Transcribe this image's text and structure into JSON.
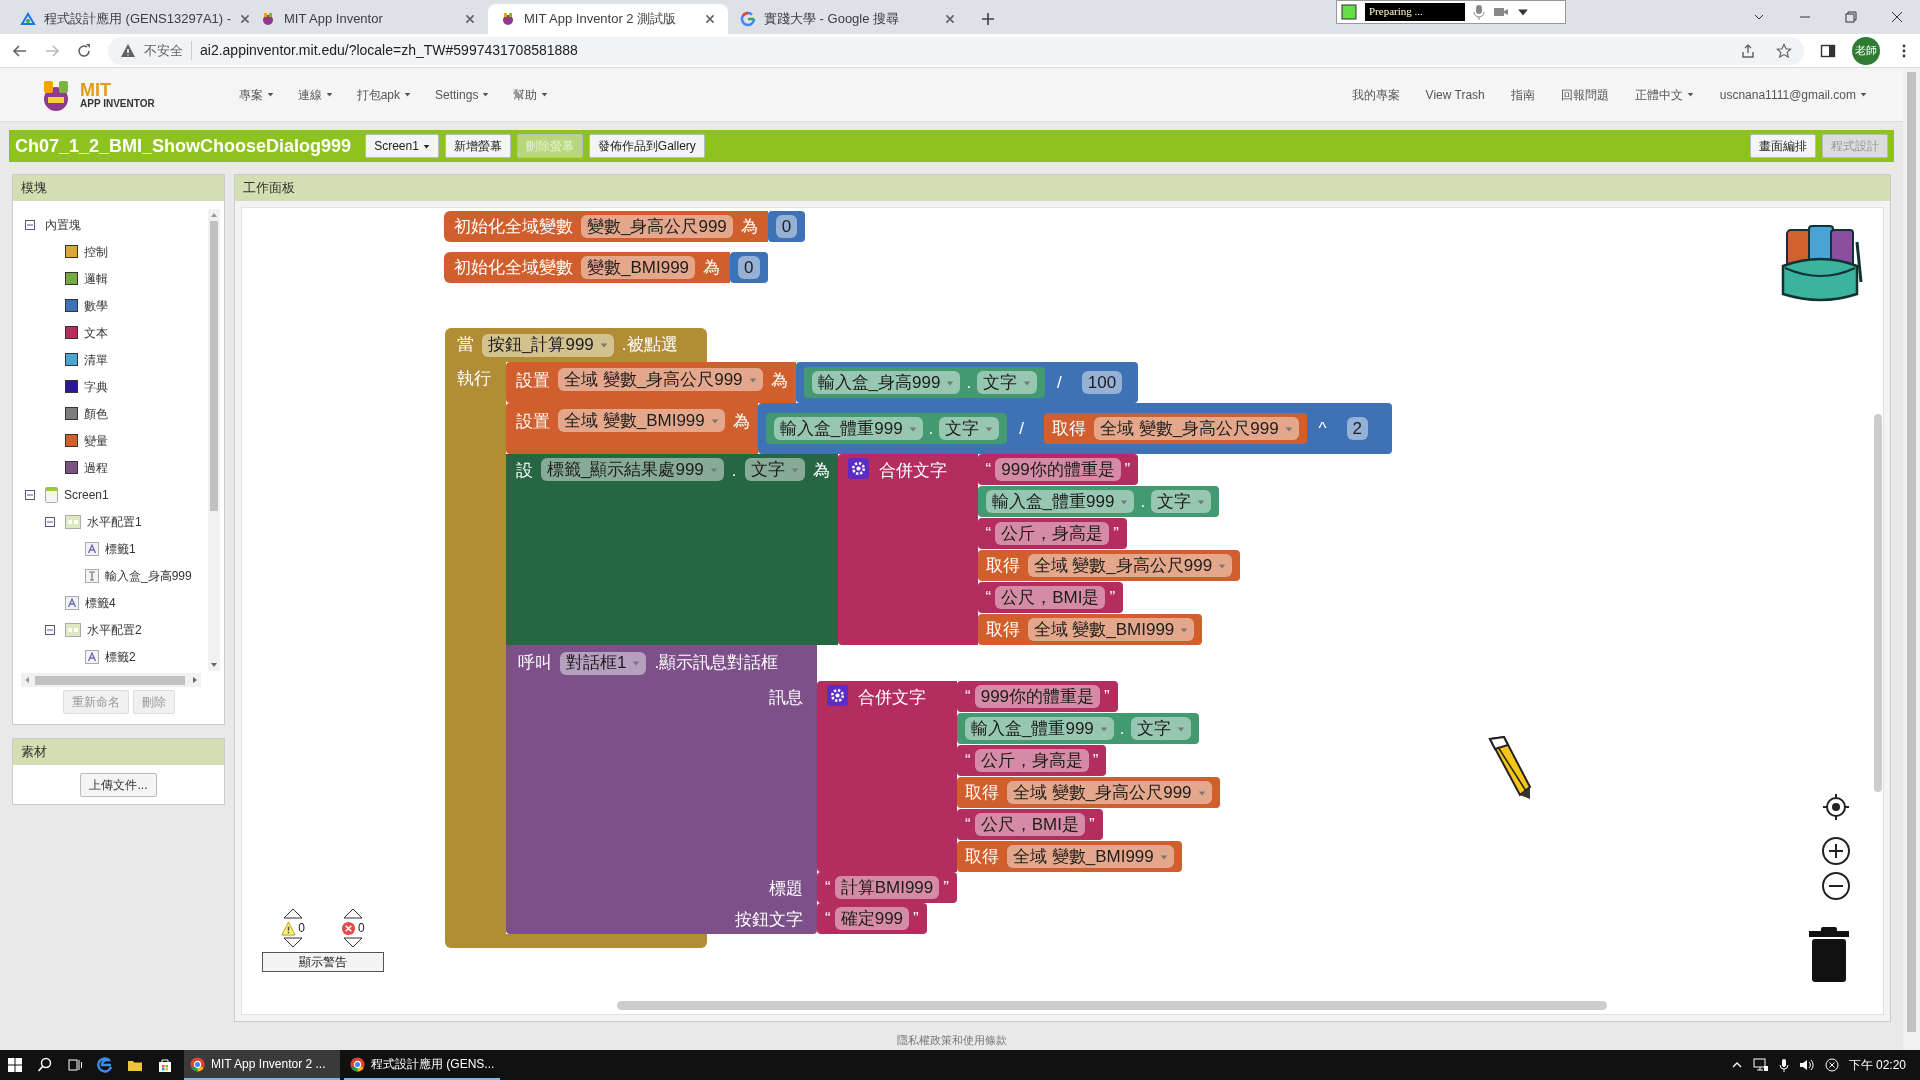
{
  "browser": {
    "tabs": [
      {
        "title": "程式設計應用 (GENS13297A1) -",
        "kind": "classroom",
        "selected": false
      },
      {
        "title": "MIT App Inventor",
        "kind": "appinventor",
        "selected": false
      },
      {
        "title": "MIT App Inventor 2 測試版",
        "kind": "appinventor",
        "selected": true
      },
      {
        "title": "實踐大學 - Google 搜尋",
        "kind": "google",
        "selected": false
      }
    ],
    "recorder": "Preparing ...",
    "security": "不安全",
    "url": "ai2.appinventor.mit.edu/?locale=zh_TW#5997431708581888",
    "profile": "老師"
  },
  "app": {
    "logo": {
      "line1": "MIT",
      "line2": "APP INVENTOR"
    },
    "menu": [
      {
        "label": "專案",
        "dropdown": true
      },
      {
        "label": "連線",
        "dropdown": true
      },
      {
        "label": "打包apk",
        "dropdown": true
      },
      {
        "label": "Settings",
        "dropdown": true
      },
      {
        "label": "幫助",
        "dropdown": true
      }
    ],
    "right_menu": [
      {
        "label": "我的專案",
        "dropdown": false
      },
      {
        "label": "View Trash",
        "dropdown": false
      },
      {
        "label": "指南",
        "dropdown": false
      },
      {
        "label": "回報問題",
        "dropdown": false
      },
      {
        "label": "正體中文",
        "dropdown": true
      },
      {
        "label": "uscnana1111@gmail.com",
        "dropdown": true
      }
    ]
  },
  "toolbar": {
    "project": "Ch07_1_2_BMI_ShowChooseDialog999",
    "buttons": [
      {
        "label": "Screen1",
        "dropdown": true,
        "disabled": false
      },
      {
        "label": "新增螢幕",
        "dropdown": false,
        "disabled": false
      },
      {
        "label": "刪除螢幕",
        "dropdown": false,
        "disabled": true
      },
      {
        "label": "發佈作品到Gallery",
        "dropdown": false,
        "disabled": false
      }
    ],
    "views": [
      {
        "label": "畫面編排",
        "selected": false
      },
      {
        "label": "程式設計",
        "selected": true
      }
    ]
  },
  "blocks_panel": {
    "title": "模塊",
    "tree": [
      {
        "label": "內置塊",
        "kind": "folder",
        "expanded": true,
        "children": [
          {
            "label": "控制",
            "kind": "category",
            "color": "#dba73b"
          },
          {
            "label": "邏輯",
            "kind": "category",
            "color": "#77ab41"
          },
          {
            "label": "數學",
            "kind": "category",
            "color": "#3f71b5"
          },
          {
            "label": "文本",
            "kind": "category",
            "color": "#b32d5e"
          },
          {
            "label": "清單",
            "kind": "category",
            "color": "#49a6d4"
          },
          {
            "label": "字典",
            "kind": "category",
            "color": "#2d1799"
          },
          {
            "label": "顏色",
            "kind": "category",
            "color": "#7d7d7d"
          },
          {
            "label": "變量",
            "kind": "category",
            "color": "#d05f2d"
          },
          {
            "label": "過程",
            "kind": "category",
            "color": "#7c5385"
          }
        ]
      },
      {
        "label": "Screen1",
        "kind": "screen",
        "expanded": true,
        "children": [
          {
            "label": "水平配置1",
            "kind": "arrangement",
            "expanded": true,
            "children": [
              {
                "label": "標籤1",
                "kind": "label"
              },
              {
                "label": "輸入盒_身高999",
                "kind": "textbox"
              }
            ]
          },
          {
            "label": "標籤4",
            "kind": "label"
          },
          {
            "label": "水平配置2",
            "kind": "arrangement",
            "expanded": true,
            "children": [
              {
                "label": "標籤2",
                "kind": "label"
              }
            ]
          }
        ]
      }
    ],
    "buttons": [
      "重新命名",
      "刪除"
    ]
  },
  "media_panel": {
    "title": "素材",
    "button": "上傳文件..."
  },
  "workspace": {
    "title": "工作面板",
    "blocks": [
      {
        "kind": "init_global",
        "label": "初始化全域變數",
        "name": "變數_身高公尺999",
        "to": "為",
        "value": {
          "kind": "number",
          "value": "0"
        }
      },
      {
        "kind": "init_global",
        "label": "初始化全域變數",
        "name": "變數_BMI999",
        "to": "為",
        "value": {
          "kind": "number",
          "value": "0"
        }
      },
      {
        "kind": "event",
        "label": "當",
        "component": "按鈕_計算999",
        "event": ".被點選",
        "do": "執行",
        "statements": [
          {
            "kind": "set_var",
            "label": "設置",
            "var": "全域 變數_身高公尺999",
            "to": "為",
            "value": {
              "kind": "math",
              "op": "/",
              "left": {
                "kind": "get_prop",
                "component": "輸入盒_身高999",
                "dot": ".",
                "property": "文字"
              },
              "right": {
                "kind": "number",
                "value": "100"
              }
            }
          },
          {
            "kind": "set_var",
            "label": "設置",
            "var": "全域 變數_BMI999",
            "to": "為",
            "value": {
              "kind": "math",
              "op": "/",
              "left": {
                "kind": "get_prop",
                "component": "輸入盒_體重999",
                "dot": ".",
                "property": "文字"
              },
              "right": {
                "kind": "math",
                "op": "^",
                "left": {
                  "kind": "get_var",
                  "label": "取得",
                  "var": "全域 變數_身高公尺999"
                },
                "right": {
                  "kind": "number",
                  "value": "2"
                }
              }
            }
          },
          {
            "kind": "set_prop",
            "label": "設",
            "component": "標籤_顯示結果處999",
            "dot": ".",
            "property": "文字",
            "to": "為",
            "value": {
              "kind": "join",
              "label": "合併文字",
              "items": [
                {
                  "kind": "text",
                  "open": "“",
                  "value": "999你的體重是",
                  "close": "”"
                },
                {
                  "kind": "get_prop",
                  "component": "輸入盒_體重999",
                  "dot": ".",
                  "property": "文字"
                },
                {
                  "kind": "text",
                  "open": "“",
                  "value": "公斤，身高是",
                  "close": "”"
                },
                {
                  "kind": "get_var",
                  "label": "取得",
                  "var": "全域 變數_身高公尺999"
                },
                {
                  "kind": "text",
                  "open": "“",
                  "value": "公尺，BMI是",
                  "close": "”"
                },
                {
                  "kind": "get_var",
                  "label": "取得",
                  "var": "全域 變數_BMI999"
                }
              ]
            }
          },
          {
            "kind": "call",
            "label": "呼叫",
            "component": "對話框1",
            "method": ".顯示訊息對話框",
            "args": [
              {
                "label": "訊息",
                "value": {
                  "kind": "join",
                  "label": "合併文字",
                  "items": [
                    {
                      "kind": "text",
                      "open": "“",
                      "value": "999你的體重是",
                      "close": "”"
                    },
                    {
                      "kind": "get_prop",
                      "component": "輸入盒_體重999",
                      "dot": ".",
                      "property": "文字"
                    },
                    {
                      "kind": "text",
                      "open": "“",
                      "value": "公斤，身高是",
                      "close": "”"
                    },
                    {
                      "kind": "get_var",
                      "label": "取得",
                      "var": "全域 變數_身高公尺999"
                    },
                    {
                      "kind": "text",
                      "open": "“",
                      "value": "公尺，BMI是",
                      "close": "”"
                    },
                    {
                      "kind": "get_var",
                      "label": "取得",
                      "var": "全域 變數_BMI999"
                    }
                  ]
                }
              },
              {
                "label": "標題",
                "value": {
                  "kind": "text",
                  "open": "“",
                  "value": "計算BMI999",
                  "close": "”"
                }
              },
              {
                "label": "按鈕文字",
                "value": {
                  "kind": "text",
                  "open": "“",
                  "value": "確定999",
                  "close": "”"
                }
              }
            ]
          }
        ]
      }
    ],
    "warnings": "0",
    "errors": "0",
    "show_warnings": "顯示警告"
  },
  "footer": "隱私權政策和使用條款",
  "taskbar": {
    "apps": [
      {
        "label": "MIT App Inventor 2 ...",
        "selected": true
      },
      {
        "label": "程式設計應用 (GENS...",
        "selected": false
      }
    ],
    "clock": "下午 02:20"
  }
}
